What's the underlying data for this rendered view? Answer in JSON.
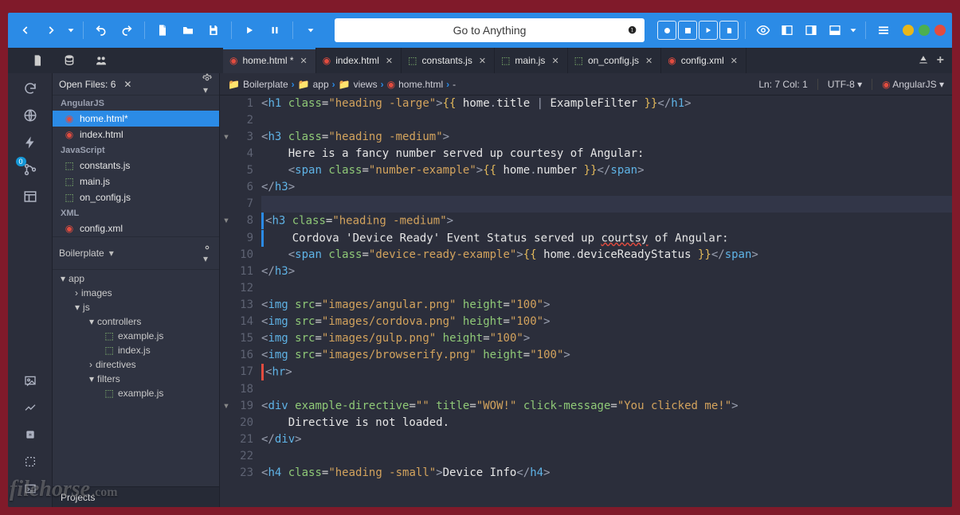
{
  "goto": {
    "placeholder": "Go to Anything"
  },
  "tabs": [
    {
      "label": "home.html *",
      "icon": "angular"
    },
    {
      "label": "index.html",
      "icon": "angular"
    },
    {
      "label": "constants.js",
      "icon": "js"
    },
    {
      "label": "main.js",
      "icon": "js"
    },
    {
      "label": "on_config.js",
      "icon": "js"
    },
    {
      "label": "config.xml",
      "icon": "angular"
    }
  ],
  "side": {
    "openfiles_title": "Open Files: 6",
    "cat1": "AngularJS",
    "cat2": "JavaScript",
    "cat3": "XML",
    "files1": [
      "home.html*",
      "index.html"
    ],
    "files2": [
      "constants.js",
      "main.js",
      "on_config.js"
    ],
    "files3": [
      "config.xml"
    ],
    "proj_title": "Boilerplate",
    "tree": {
      "app": "app",
      "images": "images",
      "js": "js",
      "controllers": "controllers",
      "examplejs": "example.js",
      "indexjs": "index.js",
      "directives": "directives",
      "filters": "filters",
      "examplejs2": "example.js"
    },
    "projects_label": "Projects"
  },
  "crumb": {
    "root": "Boilerplate",
    "app": "app",
    "views": "views",
    "file": "home.html",
    "tail": "-",
    "pos": "Ln: 7 Col: 1",
    "enc": "UTF-8",
    "lang": "AngularJS"
  },
  "rail": {
    "badge": "0"
  },
  "code": [
    {
      "n": 1,
      "fold": "",
      "html": "<span class='syn-punc'>&lt;</span><span class='syn-tag'>h1</span> <span class='syn-attr'>class</span>=<span class='syn-str'>\"heading -large\"</span><span class='syn-punc'>&gt;</span><span class='syn-var'>{{</span> <span class='syn-txt'>home</span><span class='syn-punc'>.</span><span class='syn-txt'>title</span> <span class='syn-punc'>|</span> <span class='syn-txt'>ExampleFilter</span> <span class='syn-var'>}}</span><span class='syn-punc'>&lt;/</span><span class='syn-tag'>h1</span><span class='syn-punc'>&gt;</span>"
    },
    {
      "n": 2,
      "fold": "",
      "html": " "
    },
    {
      "n": 3,
      "fold": "▾",
      "html": "<span class='syn-punc'>&lt;</span><span class='syn-tag'>h3</span> <span class='syn-attr'>class</span>=<span class='syn-str'>\"heading -medium\"</span><span class='syn-punc'>&gt;</span>"
    },
    {
      "n": 4,
      "fold": "",
      "html": "    <span class='syn-txt'>Here is a fancy number served up courtesy of Angular:</span>"
    },
    {
      "n": 5,
      "fold": "",
      "html": "    <span class='syn-punc'>&lt;</span><span class='syn-tag'>span</span> <span class='syn-attr'>class</span>=<span class='syn-str'>\"number-example\"</span><span class='syn-punc'>&gt;</span><span class='syn-var'>{{</span> <span class='syn-txt'>home</span><span class='syn-punc'>.</span><span class='syn-txt'>number</span> <span class='syn-var'>}}</span><span class='syn-punc'>&lt;/</span><span class='syn-tag'>span</span><span class='syn-punc'>&gt;</span>"
    },
    {
      "n": 6,
      "fold": "",
      "html": "<span class='syn-punc'>&lt;/</span><span class='syn-tag'>h3</span><span class='syn-punc'>&gt;</span>"
    },
    {
      "n": 7,
      "fold": "",
      "hl": true,
      "html": " "
    },
    {
      "n": 8,
      "fold": "▾",
      "mark": "blue",
      "html": "<span class='syn-punc'>&lt;</span><span class='syn-tag'>h3</span> <span class='syn-attr'>class</span>=<span class='syn-str'>\"heading -medium\"</span><span class='syn-punc'>&gt;</span>"
    },
    {
      "n": 9,
      "fold": "",
      "mark": "blue",
      "html": "    <span class='syn-txt'>Cordova 'Device Ready' Event Status served up <span class='underline-err'>courtsy</span> of Angular:</span>"
    },
    {
      "n": 10,
      "fold": "",
      "html": "    <span class='syn-punc'>&lt;</span><span class='syn-tag'>span</span> <span class='syn-attr'>class</span>=<span class='syn-str'>\"device-ready-example\"</span><span class='syn-punc'>&gt;</span><span class='syn-var'>{{</span> <span class='syn-txt'>home</span><span class='syn-punc'>.</span><span class='syn-txt'>deviceReadyStatus</span> <span class='syn-var'>}}</span><span class='syn-punc'>&lt;/</span><span class='syn-tag'>span</span><span class='syn-punc'>&gt;</span>"
    },
    {
      "n": 11,
      "fold": "",
      "html": "<span class='syn-punc'>&lt;/</span><span class='syn-tag'>h3</span><span class='syn-punc'>&gt;</span>"
    },
    {
      "n": 12,
      "fold": "",
      "html": " "
    },
    {
      "n": 13,
      "fold": "",
      "html": "<span class='syn-punc'>&lt;</span><span class='syn-tag'>img</span> <span class='syn-attr'>src</span>=<span class='syn-str'>\"images/angular.png\"</span> <span class='syn-attr'>height</span>=<span class='syn-str'>\"100\"</span><span class='syn-punc'>&gt;</span>"
    },
    {
      "n": 14,
      "fold": "",
      "html": "<span class='syn-punc'>&lt;</span><span class='syn-tag'>img</span> <span class='syn-attr'>src</span>=<span class='syn-str'>\"images/cordova.png\"</span> <span class='syn-attr'>height</span>=<span class='syn-str'>\"100\"</span><span class='syn-punc'>&gt;</span>"
    },
    {
      "n": 15,
      "fold": "",
      "html": "<span class='syn-punc'>&lt;</span><span class='syn-tag'>img</span> <span class='syn-attr'>src</span>=<span class='syn-str'>\"images/gulp.png\"</span> <span class='syn-attr'>height</span>=<span class='syn-str'>\"100\"</span><span class='syn-punc'>&gt;</span>"
    },
    {
      "n": 16,
      "fold": "",
      "html": "<span class='syn-punc'>&lt;</span><span class='syn-tag'>img</span> <span class='syn-attr'>src</span>=<span class='syn-str'>\"images/browserify.png\"</span> <span class='syn-attr'>height</span>=<span class='syn-str'>\"100\"</span><span class='syn-punc'>&gt;</span>"
    },
    {
      "n": 17,
      "fold": "",
      "mark": "red",
      "html": "<span class='syn-punc'>&lt;</span><span class='syn-tag'>hr</span><span class='syn-punc'>&gt;</span>"
    },
    {
      "n": 18,
      "fold": "",
      "html": " "
    },
    {
      "n": 19,
      "fold": "▾",
      "html": "<span class='syn-punc'>&lt;</span><span class='syn-tag'>div</span> <span class='syn-attr'>example-directive</span>=<span class='syn-str'>\"\"</span> <span class='syn-attr'>title</span>=<span class='syn-str'>\"WOW!\"</span> <span class='syn-attr'>click-message</span>=<span class='syn-str'>\"You clicked me!\"</span><span class='syn-punc'>&gt;</span>"
    },
    {
      "n": 20,
      "fold": "",
      "html": "    <span class='syn-txt'>Directive is not loaded.</span>"
    },
    {
      "n": 21,
      "fold": "",
      "html": "<span class='syn-punc'>&lt;/</span><span class='syn-tag'>div</span><span class='syn-punc'>&gt;</span>"
    },
    {
      "n": 22,
      "fold": "",
      "html": " "
    },
    {
      "n": 23,
      "fold": "",
      "html": "<span class='syn-punc'>&lt;</span><span class='syn-tag'>h4</span> <span class='syn-attr'>class</span>=<span class='syn-str'>\"heading -small\"</span><span class='syn-punc'>&gt;</span><span class='syn-txt'>Device Info</span><span class='syn-punc'>&lt;/</span><span class='syn-tag'>h4</span><span class='syn-punc'>&gt;</span>"
    }
  ],
  "watermark": "filehorse"
}
